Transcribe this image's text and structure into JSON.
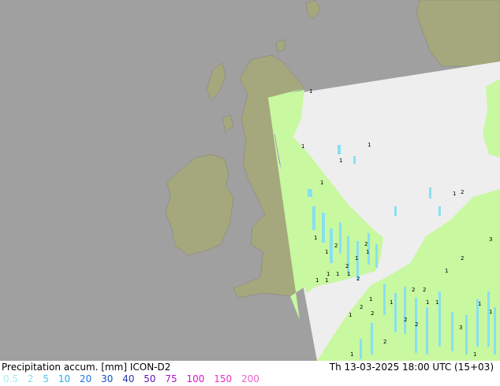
{
  "footer": {
    "title": "Precipitation accum. [mm] ICON-D2",
    "time": "Th 13-03-2025 18:00 UTC (15+03)"
  },
  "legend": {
    "items": [
      {
        "label": "0.5",
        "color": "#a8ecf0"
      },
      {
        "label": "2",
        "color": "#88dcf0"
      },
      {
        "label": "5",
        "color": "#50c8f0"
      },
      {
        "label": "10",
        "color": "#28a8f0"
      },
      {
        "label": "20",
        "color": "#1878e0"
      },
      {
        "label": "30",
        "color": "#1050c0"
      },
      {
        "label": "40",
        "color": "#2838a0"
      },
      {
        "label": "50",
        "color": "#6018b0"
      },
      {
        "label": "75",
        "color": "#b010d0"
      },
      {
        "label": "100",
        "color": "#e010d0"
      },
      {
        "label": "150",
        "color": "#f030c0"
      },
      {
        "label": "200",
        "color": "#f060d0"
      }
    ]
  },
  "colors": {
    "sea": "#a0a0a0",
    "land": "#a4a87c",
    "domain_sea": "#eeeeee",
    "domain_land": "#c8f8a0",
    "precip": "#88e0f0"
  },
  "values": [
    "1",
    "1",
    "1",
    "1",
    "1",
    "2",
    "1",
    "2",
    "1",
    "2",
    "1",
    "1",
    "2",
    "1",
    "1",
    "1",
    "1",
    "2",
    "1",
    "1",
    "3",
    "2",
    "1",
    "2",
    "2",
    "2",
    "2",
    "1",
    "1",
    "1",
    "1",
    "1",
    "2",
    "2",
    "3",
    "2",
    "1",
    "1",
    "1",
    "1"
  ]
}
